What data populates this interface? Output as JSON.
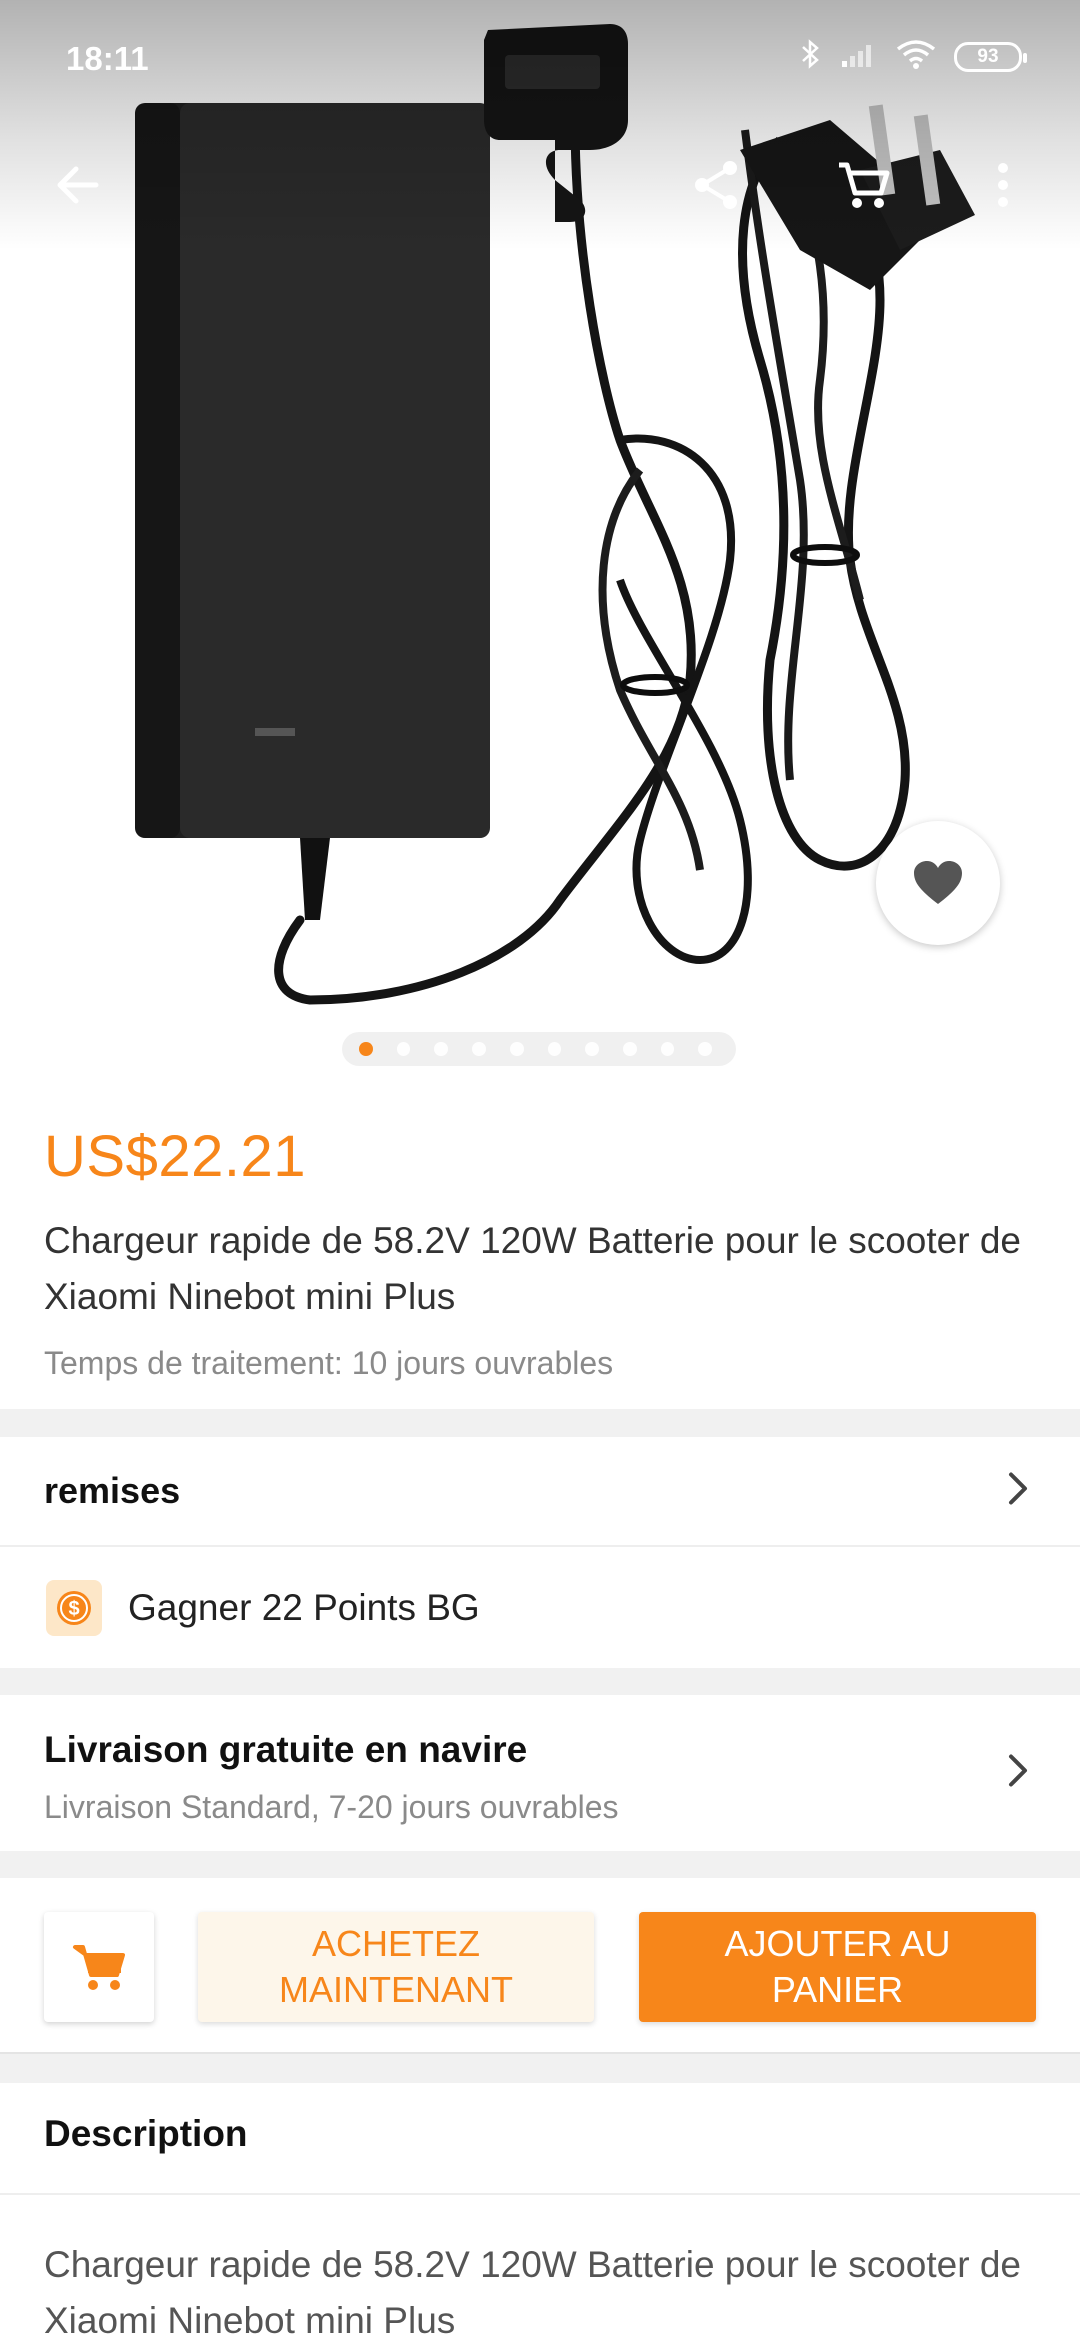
{
  "status_bar": {
    "time": "18:11",
    "battery": "93"
  },
  "product": {
    "price": "US$22.21",
    "title": "Chargeur rapide de 58.2V 120W Batterie pour le scooter de Xiaomi Ninebot mini Plus",
    "processing_time": "Temps de traitement: 10 jours ouvrables",
    "image_count": 10,
    "active_image": 1
  },
  "discounts": {
    "label": "remises",
    "points_text": "Gagner 22 Points BG"
  },
  "shipping": {
    "title": "Livraison gratuite en navire",
    "subtitle": "Livraison Standard, 7-20 jours ouvrables"
  },
  "actions": {
    "buy_now": "ACHETEZ MAINTENANT",
    "add_to_cart": "AJOUTER AU PANIER"
  },
  "description": {
    "heading": "Description",
    "body": "Chargeur rapide de 58.2V 120W Batterie pour le scooter de Xiaomi Ninebot mini Plus"
  },
  "colors": {
    "accent": "#f7861a",
    "buy_bg": "#fdf6ea"
  },
  "icons": [
    "back-arrow-icon",
    "share-icon",
    "cart-icon",
    "more-vertical-icon",
    "heart-icon",
    "coin-icon",
    "chevron-right-icon",
    "bluetooth-icon",
    "signal-icon",
    "wifi-icon",
    "battery-icon"
  ]
}
